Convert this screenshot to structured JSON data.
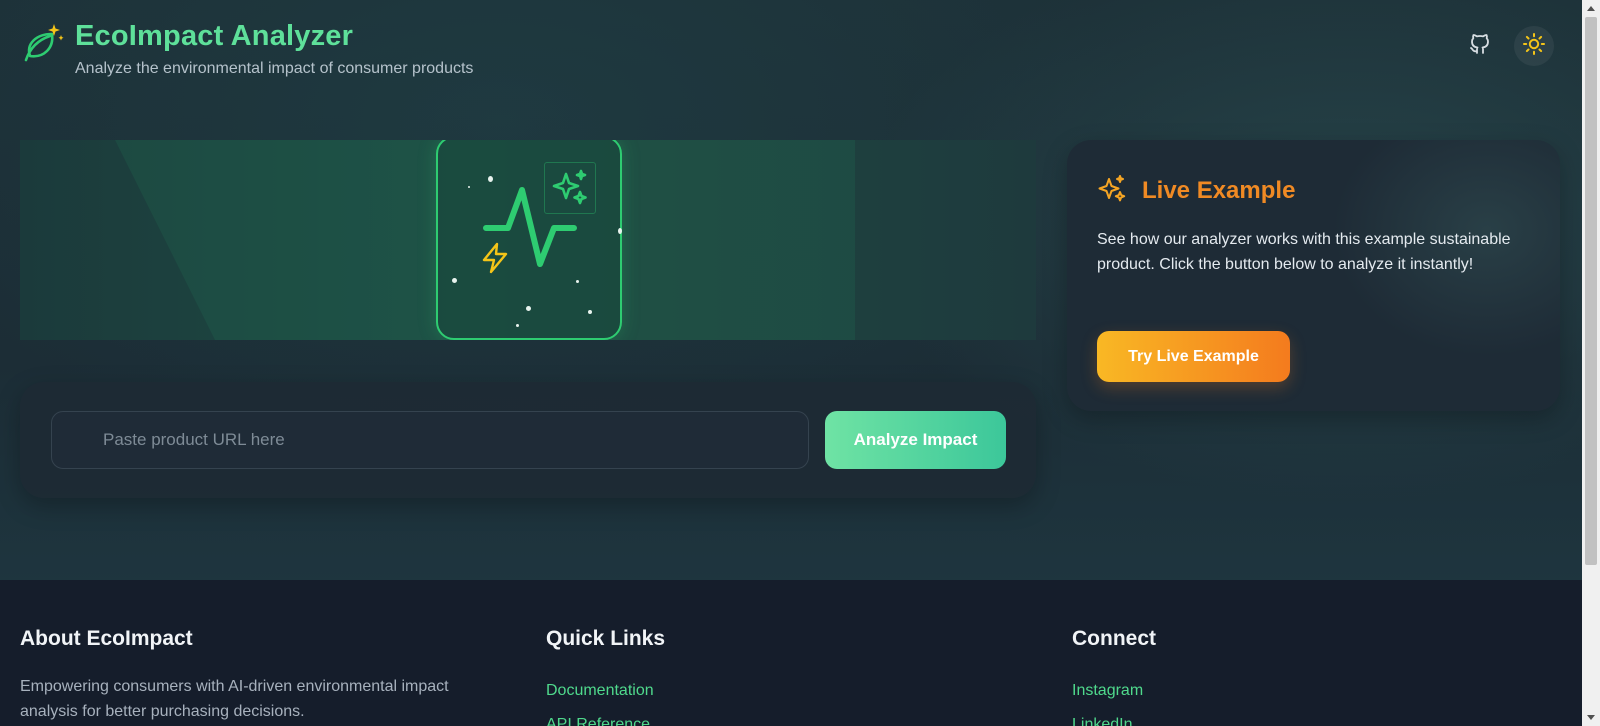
{
  "header": {
    "title": "EcoImpact Analyzer",
    "subtitle": "Analyze the environmental impact of consumer products",
    "icons": {
      "logo": "leaf-sparkle-icon",
      "github": "github-icon",
      "theme": "sun-icon"
    }
  },
  "hero": {
    "icons": [
      "activity-pulse-icon",
      "sparkles-icon",
      "lightning-icon"
    ]
  },
  "url_form": {
    "placeholder": "Paste product URL here",
    "value": "",
    "submit_label": "Analyze Impact"
  },
  "live_example": {
    "title": "Live Example",
    "description": "See how our analyzer works with this example sustainable product. Click the button below to analyze it instantly!",
    "button_label": "Try Live Example",
    "icon": "sparkles-icon"
  },
  "footer": {
    "about": {
      "heading": "About EcoImpact",
      "text": "Empowering consumers with AI-driven environmental impact analysis for better purchasing decisions."
    },
    "quick_links": {
      "heading": "Quick Links",
      "items": [
        "Documentation",
        "API Reference"
      ]
    },
    "connect": {
      "heading": "Connect",
      "items": [
        "Instagram",
        "LinkedIn"
      ]
    }
  },
  "colors": {
    "brand_green": "#5ee09a",
    "accent_green": "#2ecc71",
    "accent_orange": "#f08a24",
    "link_green": "#4fd98c",
    "sun_yellow": "#f5c518"
  }
}
